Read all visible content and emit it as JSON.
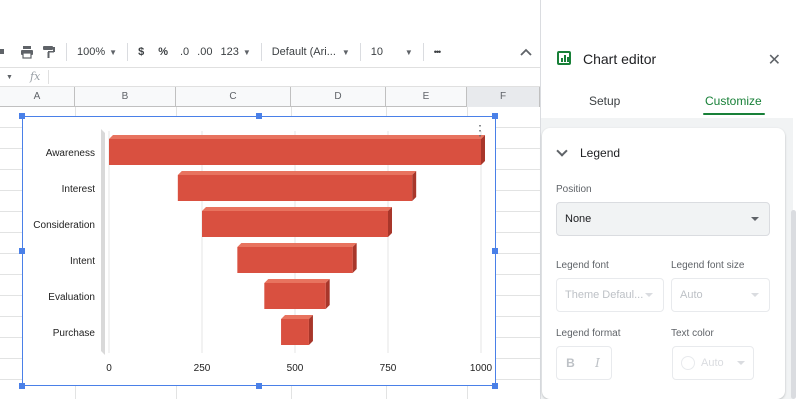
{
  "toolbar": {
    "zoom": "100%",
    "currency": "$",
    "percent": "%",
    "decrease_decimal": ".0",
    "increase_decimal": ".00",
    "more_formats": "123",
    "font": "Default (Ari...",
    "font_size": "10",
    "more": "•••"
  },
  "formula_bar": {
    "fx_label": "fx"
  },
  "columns": [
    "A",
    "B",
    "C",
    "D",
    "E",
    "F"
  ],
  "chart_data": {
    "type": "bar",
    "subtype": "funnel (3D horizontal bars, centered)",
    "categories": [
      "Awareness",
      "Interest",
      "Consideration",
      "Intent",
      "Evaluation",
      "Purchase"
    ],
    "values": [
      1000,
      630,
      500,
      310,
      165,
      75
    ],
    "xlim": [
      0,
      1000
    ],
    "xticks": [
      "0",
      "250",
      "500",
      "750",
      "1000"
    ],
    "bar_color": "#d95040",
    "grid": true,
    "legend": "none"
  },
  "editor": {
    "title": "Chart editor",
    "tabs": [
      {
        "label": "Setup",
        "active": false
      },
      {
        "label": "Customize",
        "active": true
      }
    ],
    "section_title": "Legend",
    "position_label": "Position",
    "position_value": "None",
    "legend_font_label": "Legend font",
    "legend_font_value": "Theme Defaul...",
    "legend_font_size_label": "Legend font size",
    "legend_font_size_value": "Auto",
    "legend_format_label": "Legend format",
    "bold_label": "B",
    "italic_label": "I",
    "text_color_label": "Text color",
    "text_color_value": "Auto"
  },
  "colors": {
    "accent": "#188038",
    "selection": "#4a80e8"
  }
}
